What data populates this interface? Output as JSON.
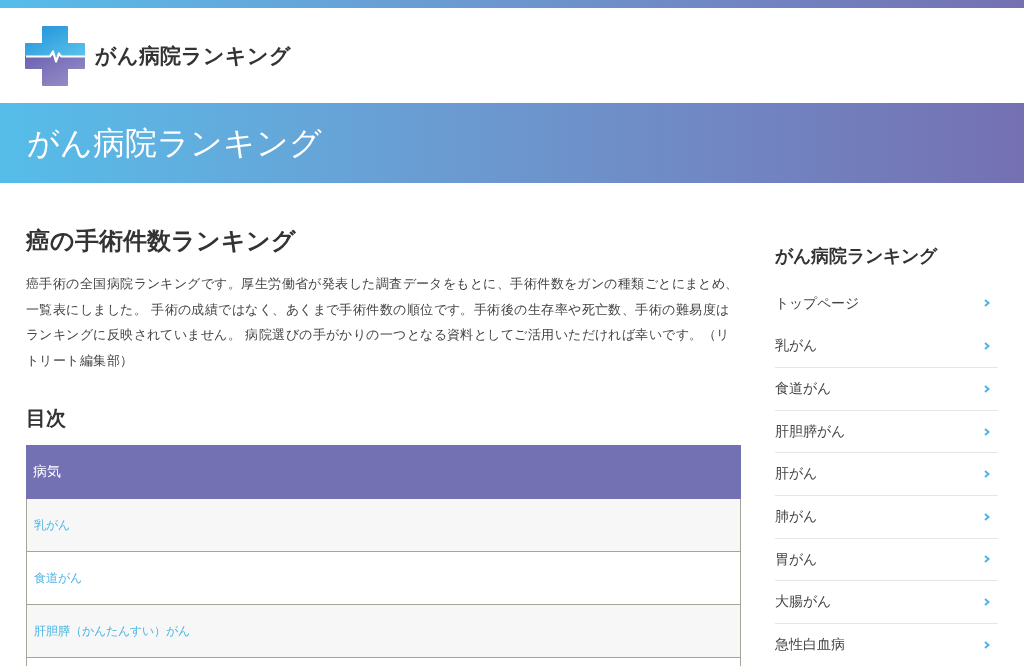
{
  "header": {
    "site_title": "がん病院ランキング"
  },
  "banner": {
    "title": "がん病院ランキング"
  },
  "article": {
    "title": "癌の手術件数ランキング",
    "intro": "癌手術の全国病院ランキングです。厚生労働省が発表した調査データをもとに、手術件数をガンの種類ごとにまとめ、一覧表にしました。 手術の成績ではなく、あくまで手術件数の順位です。手術後の生存率や死亡数、手術の難易度はランキングに反映されていません。 病院選びの手がかりの一つとなる資料としてご活用いただければ幸いです。（リトリート編集部）",
    "toc": {
      "heading": "目次",
      "table": {
        "columns": [
          "病気"
        ],
        "rows": [
          "乳がん",
          "食道がん",
          "肝胆膵（かんたんすい）がん"
        ]
      }
    }
  },
  "sidebar": {
    "heading": "がん病院ランキング",
    "items": [
      "トップページ",
      "乳がん",
      "食道がん",
      "肝胆膵がん",
      "肝がん",
      "肺がん",
      "胃がん",
      "大腸がん",
      "急性白血病"
    ]
  }
}
